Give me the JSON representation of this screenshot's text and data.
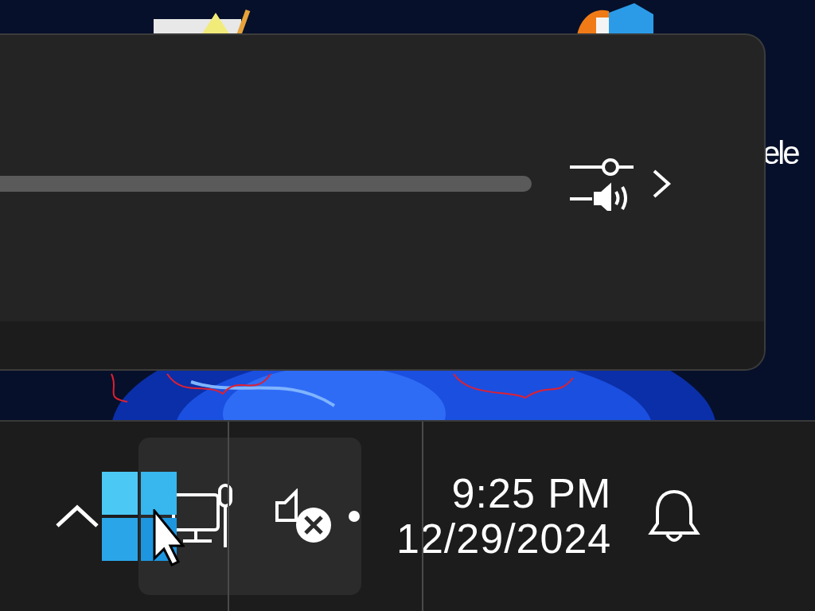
{
  "desktop": {
    "label": "ele"
  },
  "taskbar": {
    "tray_group": {
      "highlighted": true
    },
    "volume": {
      "muted": true
    },
    "clock": {
      "time": "9:25 PM",
      "date": "12/29/2024"
    }
  }
}
